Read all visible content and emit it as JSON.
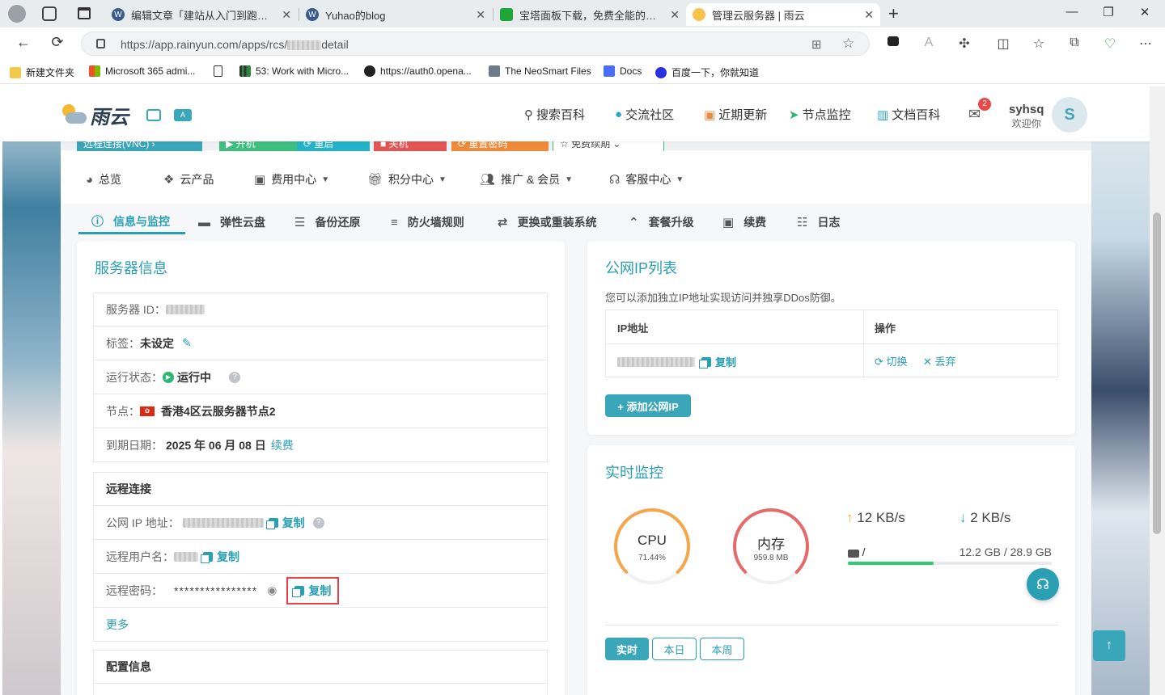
{
  "browser": {
    "tabs": [
      {
        "title": "编辑文章「建站从入门到跑路（…",
        "icon": "wordpress-icon"
      },
      {
        "title": "Yuhao的blog",
        "icon": "wordpress-icon"
      },
      {
        "title": "宝塔面板下载，免费全能的服务器…",
        "icon": "baota-icon"
      },
      {
        "title": "管理云服务器 | 雨云",
        "icon": "rainyun-icon"
      }
    ],
    "url_prefix": "https://app.rainyun.com/apps/rcs/",
    "url_suffix": "detail",
    "bookmarks": [
      {
        "label": "新建文件夹"
      },
      {
        "label": "Microsoft 365 admi..."
      },
      {
        "label": ""
      },
      {
        "label": "53: Work with Micro..."
      },
      {
        "label": "https://auth0.opena..."
      },
      {
        "label": "The NeoSmart Files"
      },
      {
        "label": "Docs"
      },
      {
        "label": "百度一下，你就知道"
      }
    ]
  },
  "site": {
    "brand": "雨云",
    "nav": [
      {
        "label": "搜索百科",
        "icon": "search-icon"
      },
      {
        "label": "交流社区",
        "icon": "community-icon"
      },
      {
        "label": "近期更新",
        "icon": "updates-icon"
      },
      {
        "label": "节点监控",
        "icon": "monitor-icon"
      },
      {
        "label": "文档百科",
        "icon": "book-icon"
      }
    ],
    "message_badge": "2",
    "user": {
      "name": "syhsq",
      "welcome": "欢迎你",
      "avatar": "S"
    },
    "action_strip": [
      "远程连接(VNC) ›",
      "▶ 开机",
      "⟳ 重启",
      "■ 关机",
      "⟳ 重置密码",
      "☆ 免费续期 ⌄"
    ],
    "menu": [
      {
        "label": "总览",
        "dropdown": false
      },
      {
        "label": "云产品",
        "dropdown": false
      },
      {
        "label": "费用中心",
        "dropdown": true
      },
      {
        "label": "积分中心",
        "dropdown": true
      },
      {
        "label": "推广 & 会员",
        "dropdown": true
      },
      {
        "label": "客服中心",
        "dropdown": true
      }
    ],
    "subtabs": [
      "信息与监控",
      "弹性云盘",
      "备份还原",
      "防火墙规则",
      "更换或重装系统",
      "套餐升级",
      "续费",
      "日志"
    ]
  },
  "server_info": {
    "title": "服务器信息",
    "id_label": "服务器 ID：",
    "tag_label": "标签：",
    "tag_value": "未设定",
    "status_label": "运行状态：",
    "status_value": "运行中",
    "node_label": "节点：",
    "node_value": "香港4区云服务器节点2",
    "expire_label": "到期日期：",
    "expire_value": "2025 年 06 月 08 日",
    "renew_link": "续费",
    "remote_title": "远程连接",
    "ip_label": "公网 IP 地址：",
    "user_label": "远程用户名：",
    "password_label": "远程密码：",
    "password_mask": "****************",
    "copy_label": "复制",
    "more_label": "更多",
    "config_title": "配置信息"
  },
  "ip_list": {
    "title": "公网IP列表",
    "description": "您可以添加独立IP地址实现访问并独享DDos防御。",
    "col_ip": "IP地址",
    "col_action": "操作",
    "copy_label": "复制",
    "switch_label": "切换",
    "discard_label": "丢弃",
    "add_button": "+ 添加公网IP"
  },
  "monitor": {
    "title": "实时监控",
    "cpu_label": "CPU",
    "cpu_value": "71.44%",
    "cpu_fraction": 0.7144,
    "mem_label": "内存",
    "mem_value": "959.8 MB",
    "upload_speed": "12 KB/s",
    "download_speed": "2 KB/s",
    "disk_label": "/",
    "disk_usage": "12.2 GB / 28.9 GB",
    "disk_fraction": 0.42,
    "range_buttons": [
      "实时",
      "本日",
      "本周"
    ],
    "colors": {
      "cpu": "#f5a54a",
      "mem": "#e56b6b",
      "accent": "#2a9fb3",
      "disk": "#2ecc71"
    }
  }
}
